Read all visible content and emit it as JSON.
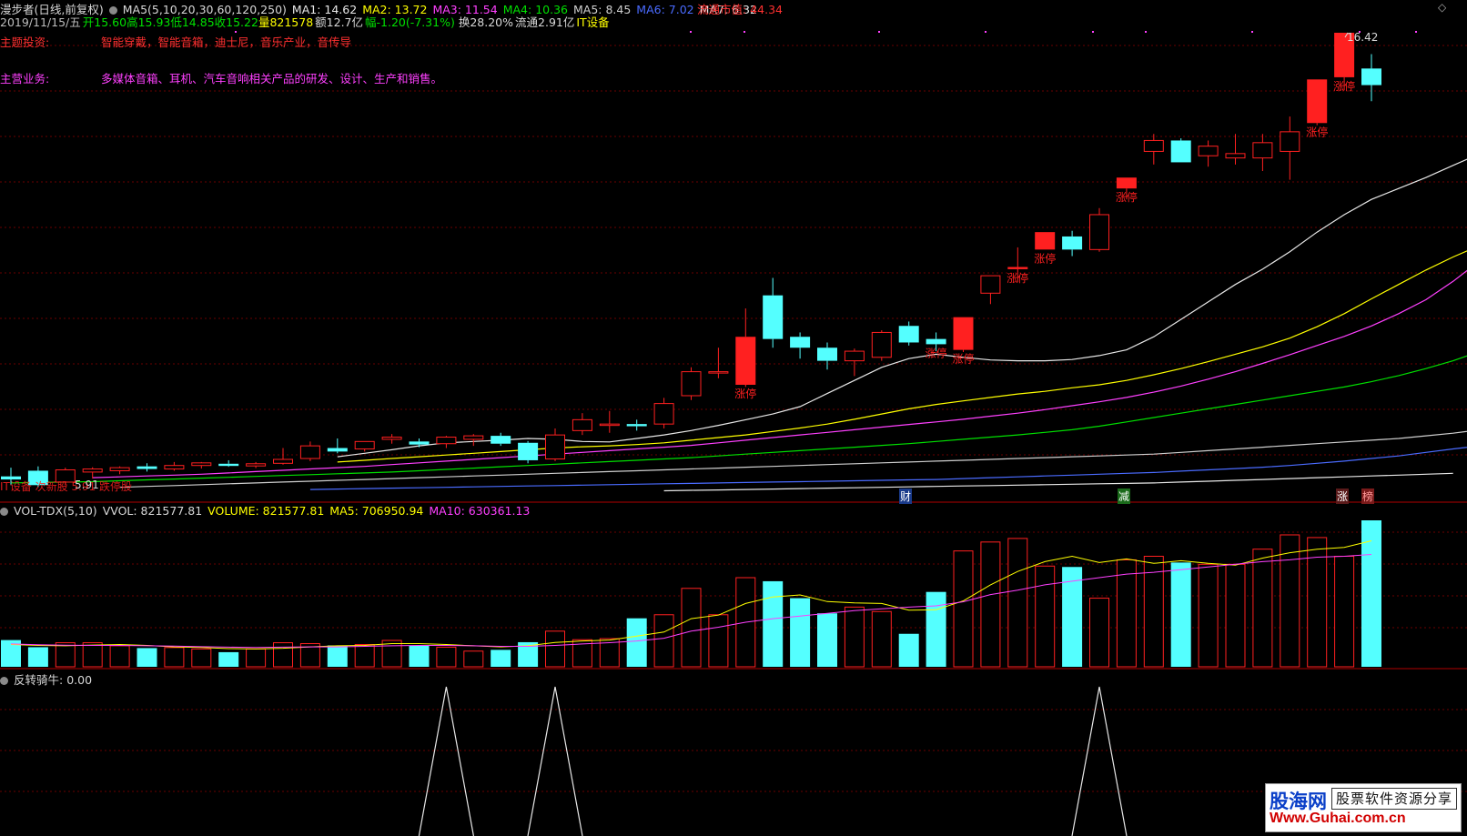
{
  "header": {
    "title": "漫步者(日线,前复权)",
    "ma_params": "MA5(5,10,20,30,60,120,250)",
    "ma_values": [
      {
        "label": "MA1: 14.62",
        "color": "#e8e8e8"
      },
      {
        "label": "MA2: 13.72",
        "color": "#ffff00"
      },
      {
        "label": "MA3: 11.54",
        "color": "#ff40ff"
      },
      {
        "label": "MA4: 10.36",
        "color": "#00e000"
      },
      {
        "label": "MA5: 8.45",
        "color": "#cfcfcf"
      },
      {
        "label": "MA6: 7.02",
        "color": "#4a6bff"
      },
      {
        "label": "MA7: 6.32",
        "color": "#e8e8e8"
      }
    ],
    "market_cap": "流通市值: 44.34",
    "date": "2019/11/15/五",
    "open": "开15.60",
    "high": "高15.93",
    "low": "低14.85",
    "close": "收15.22",
    "volume": "量821578",
    "amount": "额12.7亿",
    "change": "幅-1.20(-7.31%)",
    "turnover": "换28.20%",
    "float_shares": "流通2.91亿",
    "sector": "IT设备"
  },
  "info": {
    "theme_label": "主题投资:",
    "theme_value": "智能穿戴，智能音箱，迪士尼，音乐产业，音传导",
    "business_label": "主营业务:",
    "business_value": "多媒体音箱、耳机、汽车音响相关产品的研发、设计、生产和销售。"
  },
  "main_chart": {
    "max_label": "16.42",
    "min_label": "5.91",
    "limit_up_label": "涨停",
    "bottom_overlay_text": "IT设备 次新股 5.91 跌停股",
    "markers": [
      "财",
      "减",
      "涨",
      "榜"
    ]
  },
  "volume_panel": {
    "name": "VOL-TDX(5,10)",
    "vvol": "VVOL: 821577.81",
    "volume_label": "VOLUME: 821577.81",
    "ma5_label": "MA5: 706950.94",
    "ma10_label": "MA10: 630361.13"
  },
  "indicator_panel": {
    "name": "反转骑牛",
    "value": ": 0.00"
  },
  "watermark": {
    "brand": "股海网",
    "slogan": "股票软件资源分享",
    "url": "Www.Guhai.com.cn"
  },
  "colors": {
    "up": "#ff2020",
    "down": "#54ffff",
    "grid": "#6a0000",
    "divider": "#b00000"
  },
  "chart_data": {
    "type": "candlestick",
    "price_range": [
      5.91,
      16.42
    ],
    "candles": [
      {
        "o": 6.25,
        "h": 6.45,
        "l": 6.05,
        "c": 6.18
      },
      {
        "o": 6.38,
        "h": 6.48,
        "l": 6.0,
        "c": 6.05
      },
      {
        "o": 6.12,
        "h": 6.45,
        "l": 6.05,
        "c": 6.4
      },
      {
        "o": 6.35,
        "h": 6.46,
        "l": 6.2,
        "c": 6.42
      },
      {
        "o": 6.38,
        "h": 6.48,
        "l": 6.3,
        "c": 6.45
      },
      {
        "o": 6.48,
        "h": 6.55,
        "l": 6.36,
        "c": 6.42
      },
      {
        "o": 6.42,
        "h": 6.58,
        "l": 6.38,
        "c": 6.5
      },
      {
        "o": 6.5,
        "h": 6.58,
        "l": 6.43,
        "c": 6.56
      },
      {
        "o": 6.54,
        "h": 6.62,
        "l": 6.47,
        "c": 6.49
      },
      {
        "o": 6.49,
        "h": 6.58,
        "l": 6.44,
        "c": 6.54
      },
      {
        "o": 6.55,
        "h": 6.9,
        "l": 6.52,
        "c": 6.64
      },
      {
        "o": 6.66,
        "h": 7.05,
        "l": 6.6,
        "c": 6.95
      },
      {
        "o": 6.9,
        "h": 7.12,
        "l": 6.78,
        "c": 6.82
      },
      {
        "o": 6.88,
        "h": 7.05,
        "l": 6.82,
        "c": 7.05
      },
      {
        "o": 7.1,
        "h": 7.22,
        "l": 7.0,
        "c": 7.15
      },
      {
        "o": 7.05,
        "h": 7.12,
        "l": 6.92,
        "c": 6.98
      },
      {
        "o": 7.0,
        "h": 7.18,
        "l": 6.9,
        "c": 7.15
      },
      {
        "o": 7.1,
        "h": 7.22,
        "l": 6.95,
        "c": 7.18
      },
      {
        "o": 7.18,
        "h": 7.25,
        "l": 6.95,
        "c": 7.0
      },
      {
        "o": 7.02,
        "h": 7.06,
        "l": 6.55,
        "c": 6.62
      },
      {
        "o": 6.65,
        "h": 7.35,
        "l": 6.6,
        "c": 7.2
      },
      {
        "o": 7.3,
        "h": 7.7,
        "l": 7.2,
        "c": 7.55
      },
      {
        "o": 7.45,
        "h": 7.75,
        "l": 7.25,
        "c": 7.45
      },
      {
        "o": 7.45,
        "h": 7.55,
        "l": 7.3,
        "c": 7.4
      },
      {
        "o": 7.45,
        "h": 8.05,
        "l": 7.35,
        "c": 7.92
      },
      {
        "o": 8.1,
        "h": 8.75,
        "l": 8.0,
        "c": 8.65
      },
      {
        "o": 8.65,
        "h": 9.2,
        "l": 8.5,
        "c": 8.65
      },
      {
        "o": 8.35,
        "h": 10.1,
        "l": 8.3,
        "c": 9.45
      },
      {
        "o": 10.4,
        "h": 10.8,
        "l": 9.2,
        "c": 9.4
      },
      {
        "o": 9.45,
        "h": 9.55,
        "l": 8.95,
        "c": 9.2
      },
      {
        "o": 9.2,
        "h": 9.32,
        "l": 8.7,
        "c": 8.9
      },
      {
        "o": 8.9,
        "h": 9.18,
        "l": 8.55,
        "c": 9.12
      },
      {
        "o": 8.98,
        "h": 9.6,
        "l": 8.9,
        "c": 9.55
      },
      {
        "o": 9.7,
        "h": 9.8,
        "l": 9.25,
        "c": 9.32
      },
      {
        "o": 9.4,
        "h": 9.55,
        "l": 9.12,
        "c": 9.28
      },
      {
        "o": 9.15,
        "h": 9.9,
        "l": 9.1,
        "c": 9.9
      },
      {
        "o": 10.45,
        "h": 10.85,
        "l": 10.2,
        "c": 10.85
      },
      {
        "o": 11.0,
        "h": 11.5,
        "l": 10.7,
        "c": 11.05
      },
      {
        "o": 11.45,
        "h": 11.85,
        "l": 11.45,
        "c": 11.85
      },
      {
        "o": 11.75,
        "h": 11.88,
        "l": 11.3,
        "c": 11.45
      },
      {
        "o": 11.45,
        "h": 12.4,
        "l": 11.4,
        "c": 12.25
      },
      {
        "o": 12.85,
        "h": 13.1,
        "l": 12.6,
        "c": 13.1
      },
      {
        "o": 13.7,
        "h": 14.1,
        "l": 13.4,
        "c": 13.95
      },
      {
        "o": 13.95,
        "h": 14.0,
        "l": 13.45,
        "c": 13.45
      },
      {
        "o": 13.6,
        "h": 13.95,
        "l": 13.35,
        "c": 13.82
      },
      {
        "o": 13.55,
        "h": 14.1,
        "l": 13.4,
        "c": 13.65
      },
      {
        "o": 13.55,
        "h": 14.1,
        "l": 13.25,
        "c": 13.9
      },
      {
        "o": 13.7,
        "h": 14.5,
        "l": 13.05,
        "c": 14.15
      },
      {
        "o": 14.35,
        "h": 15.35,
        "l": 14.3,
        "c": 15.35
      },
      {
        "o": 15.4,
        "h": 16.42,
        "l": 15.1,
        "c": 16.42
      },
      {
        "o": 15.6,
        "h": 15.93,
        "l": 14.85,
        "c": 15.22
      }
    ],
    "limit_up_indices": [
      27,
      34,
      35,
      37,
      38,
      41,
      48,
      49
    ],
    "ma_series": [
      {
        "name": "MA1",
        "color": "#e8e8e8",
        "start": 12,
        "values": [
          6.7,
          6.78,
          6.86,
          6.95,
          7.02,
          7.05,
          7.08,
          7.12,
          7.1,
          7.05,
          7.04,
          7.12,
          7.2,
          7.3,
          7.42,
          7.55,
          7.68,
          7.85,
          8.15,
          8.45,
          8.75,
          8.95,
          9.05,
          8.98,
          8.92,
          8.9,
          8.9,
          8.93,
          9.02,
          9.15,
          9.45,
          9.85,
          10.25,
          10.65,
          11.0,
          11.4,
          11.85,
          12.25,
          12.6,
          12.85,
          13.1,
          13.38,
          13.65,
          13.75,
          13.9,
          14.0,
          14.25,
          14.85,
          15.6,
          16.1
        ]
      },
      {
        "name": "MA2",
        "color": "#ffff00",
        "start": 12,
        "values": [
          6.58,
          6.62,
          6.66,
          6.7,
          6.74,
          6.78,
          6.82,
          6.86,
          6.9,
          6.93,
          6.95,
          6.98,
          7.02,
          7.08,
          7.14,
          7.2,
          7.28,
          7.36,
          7.45,
          7.56,
          7.68,
          7.8,
          7.9,
          7.98,
          8.06,
          8.14,
          8.2,
          8.28,
          8.35,
          8.45,
          8.58,
          8.72,
          8.88,
          9.05,
          9.22,
          9.42,
          9.68,
          9.98,
          10.32,
          10.65,
          10.98,
          11.28,
          11.55,
          11.8,
          12.0,
          12.18,
          12.35,
          12.6,
          12.95,
          13.72
        ]
      },
      {
        "name": "MA3",
        "color": "#ff40ff",
        "start": 3,
        "values": [
          6.22,
          6.24,
          6.26,
          6.28,
          6.3,
          6.33,
          6.36,
          6.39,
          6.42,
          6.45,
          6.48,
          6.52,
          6.56,
          6.6,
          6.64,
          6.68,
          6.72,
          6.76,
          6.8,
          6.84,
          6.88,
          6.92,
          6.96,
          7.02,
          7.08,
          7.14,
          7.2,
          7.26,
          7.32,
          7.38,
          7.44,
          7.5,
          7.56,
          7.63,
          7.7,
          7.78,
          7.87,
          7.96,
          8.06,
          8.18,
          8.32,
          8.48,
          8.65,
          8.84,
          9.04,
          9.25,
          9.46,
          9.7,
          9.98,
          10.3,
          10.72,
          11.2,
          11.54
        ]
      },
      {
        "name": "MA4",
        "color": "#00e000",
        "start": 0,
        "values": [
          6.1,
          6.11,
          6.12,
          6.13,
          6.15,
          6.17,
          6.19,
          6.21,
          6.23,
          6.25,
          6.27,
          6.29,
          6.31,
          6.33,
          6.35,
          6.38,
          6.41,
          6.44,
          6.47,
          6.5,
          6.53,
          6.56,
          6.59,
          6.62,
          6.65,
          6.68,
          6.72,
          6.76,
          6.8,
          6.84,
          6.88,
          6.92,
          6.96,
          7.0,
          7.05,
          7.1,
          7.15,
          7.2,
          7.26,
          7.32,
          7.4,
          7.5,
          7.6,
          7.7,
          7.8,
          7.9,
          8.0,
          8.1,
          8.2,
          8.3,
          8.42,
          8.56,
          8.72,
          8.9,
          9.12,
          9.38,
          9.7,
          10.02,
          10.36
        ]
      },
      {
        "name": "MA5",
        "color": "#cfcfcf",
        "start": 4,
        "values": [
          6.0,
          6.02,
          6.04,
          6.06,
          6.08,
          6.1,
          6.12,
          6.14,
          6.16,
          6.18,
          6.2,
          6.22,
          6.24,
          6.26,
          6.28,
          6.3,
          6.32,
          6.34,
          6.36,
          6.38,
          6.4,
          6.42,
          6.44,
          6.46,
          6.48,
          6.5,
          6.52,
          6.54,
          6.56,
          6.58,
          6.6,
          6.62,
          6.64,
          6.66,
          6.68,
          6.7,
          6.72,
          6.74,
          6.76,
          6.8,
          6.84,
          6.88,
          6.92,
          6.96,
          7.0,
          7.04,
          7.08,
          7.12,
          7.18,
          7.24,
          7.32,
          7.42,
          7.55,
          7.7,
          7.88,
          8.08,
          8.3,
          8.45
        ]
      },
      {
        "name": "MA6",
        "color": "#4a6bff",
        "start": 11,
        "values": [
          5.95,
          5.96,
          5.97,
          5.98,
          5.99,
          6.0,
          6.01,
          6.02,
          6.03,
          6.04,
          6.05,
          6.06,
          6.07,
          6.08,
          6.09,
          6.1,
          6.11,
          6.12,
          6.13,
          6.14,
          6.15,
          6.16,
          6.17,
          6.18,
          6.2,
          6.22,
          6.24,
          6.26,
          6.28,
          6.3,
          6.32,
          6.34,
          6.37,
          6.4,
          6.43,
          6.46,
          6.5,
          6.55,
          6.6,
          6.66,
          6.72,
          6.8,
          6.88,
          6.95,
          7.02
        ]
      },
      {
        "name": "MA7",
        "color": "#e8e8e8",
        "start": 24,
        "values": [
          5.92,
          5.93,
          5.94,
          5.95,
          5.96,
          5.97,
          5.98,
          5.99,
          6.0,
          6.01,
          6.02,
          6.03,
          6.04,
          6.05,
          6.06,
          6.07,
          6.08,
          6.09,
          6.1,
          6.12,
          6.14,
          6.16,
          6.18,
          6.2,
          6.22,
          6.24,
          6.26,
          6.28,
          6.3,
          6.32
        ]
      }
    ],
    "volume": {
      "max": 821577.81,
      "bars": [
        150,
        110,
        135,
        135,
        118,
        105,
        108,
        100,
        82,
        100,
        135,
        130,
        120,
        125,
        148,
        120,
        110,
        88,
        95,
        138,
        200,
        152,
        158,
        272,
        292,
        440,
        292,
        500,
        480,
        385,
        300,
        335,
        310,
        185,
        420,
        650,
        700,
        720,
        565,
        560,
        385,
        600,
        620,
        585,
        575,
        575,
        660,
        740,
        725,
        620,
        821.58
      ],
      "unit_thousands": true,
      "ma5": [
        125,
        120,
        118,
        122,
        125,
        120,
        112,
        108,
        102,
        100,
        104,
        112,
        118,
        120,
        130,
        130,
        125,
        118,
        112,
        118,
        136,
        145,
        150,
        172,
        195,
        270,
        290,
        355,
        392,
        403,
        366,
        358,
        355,
        318,
        320,
        370,
        460,
        535,
        590,
        620,
        585,
        605,
        580,
        595,
        580,
        570,
        610,
        640,
        660,
        670,
        707
      ],
      "ma10": [
        128,
        124,
        121,
        120,
        120,
        118,
        116,
        113,
        110,
        108,
        110,
        112,
        112,
        115,
        118,
        120,
        120,
        118,
        115,
        115,
        120,
        128,
        135,
        145,
        160,
        200,
        222,
        250,
        270,
        285,
        300,
        315,
        325,
        335,
        342,
        365,
        405,
        430,
        460,
        480,
        500,
        520,
        530,
        545,
        560,
        575,
        590,
        600,
        615,
        620,
        630
      ]
    },
    "reversal_peaks": [
      16,
      20,
      40
    ]
  }
}
